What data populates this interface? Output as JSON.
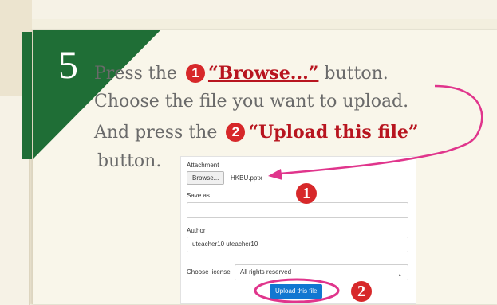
{
  "step": {
    "number": "5"
  },
  "instructions": {
    "line1_prefix": "Press the",
    "line1_marker": "1",
    "line1_quoted": "“Browse...”",
    "line1_suffix": " button.",
    "line2": "Choose the file you want to upload.",
    "line3_prefix": "And press the",
    "line3_marker": "2",
    "line3_quoted": "“Upload this file”",
    "line4": "button."
  },
  "form": {
    "attachment_label": "Attachment",
    "browse_label": "Browse...",
    "file_name": "HKBU.pptx",
    "save_as_label": "Save as",
    "save_as_value": "",
    "author_label": "Author",
    "author_value": "uteacher10 uteacher10",
    "license_label": "Choose license",
    "license_value": "All rights reserved",
    "upload_label": "Upload this file"
  },
  "annotations": {
    "badge1": "1",
    "badge2": "2"
  },
  "colors": {
    "green": "#1f6e36",
    "red": "#d7282a",
    "magenta": "#e0358c",
    "button_blue": "#1177d1"
  }
}
